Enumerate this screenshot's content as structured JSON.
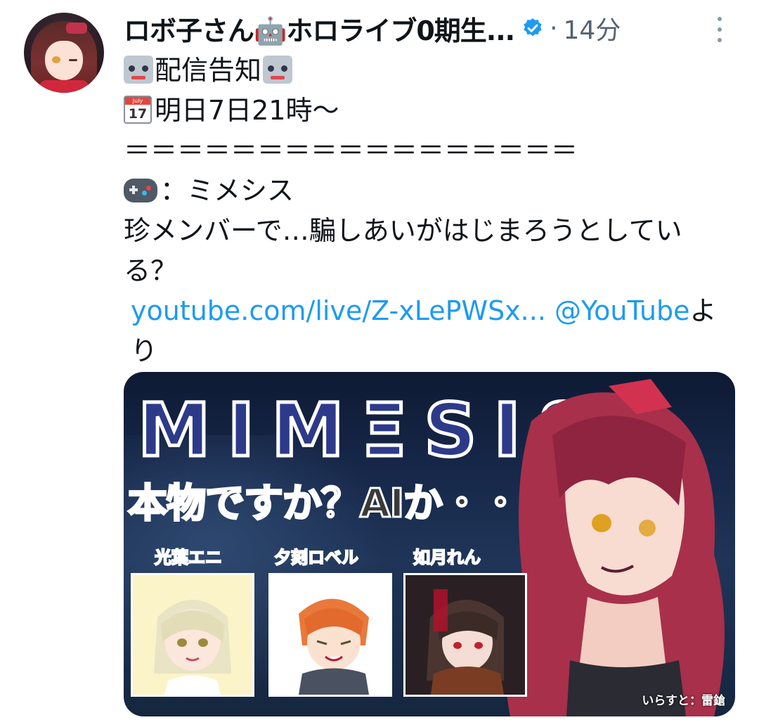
{
  "tweet": {
    "author_name": "ロボ子さん🤖ホロライブ0期生...",
    "time_separator": "·",
    "time": "14分",
    "lines": {
      "l1_text": "配信告知",
      "l2_text": "明日7日21時〜",
      "l3_text": "＝＝＝＝＝＝＝＝＝＝＝＝＝＝＝＝＝",
      "l4_text": "：ミメシス",
      "l5_text": "珍メンバーで…騙しあいがはじまろうとしている？",
      "link_url": "youtube.com/live/Z-xLePWSx...",
      "link_mention": "@YouTube",
      "link_suffix": "より"
    },
    "calendar_emoji": {
      "month": "July",
      "day": "17"
    }
  },
  "media": {
    "title": "MIMΞSIS",
    "subtitle": "本物ですか？AIか・・・？",
    "members": [
      "光葉エニ",
      "夕刻ロベル",
      "如月れん"
    ],
    "credit": "いらすと：雷鎗"
  },
  "colors": {
    "text": "#0f1419",
    "secondary": "#536471",
    "link": "#1d9bf0",
    "verified": "#1d9bf0"
  }
}
